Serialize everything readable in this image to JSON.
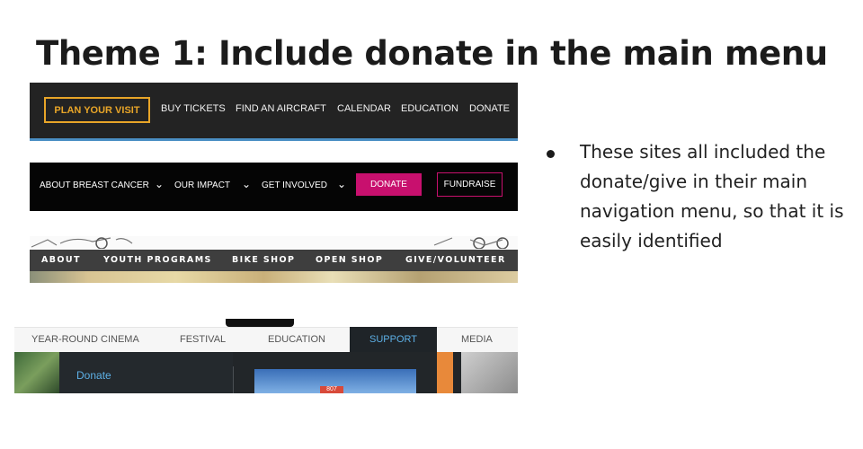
{
  "slide": {
    "title": "Theme 1: Include donate in the main menu",
    "bullet": "These sites all included the donate/give in their main navigation menu, so that it is easily identified"
  },
  "site1": {
    "plan_label": "PLAN YOUR VISIT",
    "nav": [
      "BUY TICKETS",
      "FIND AN AIRCRAFT",
      "CALENDAR",
      "EDUCATION",
      "DONATE"
    ],
    "accent_color": "#e8a528"
  },
  "site2": {
    "nav": [
      "ABOUT BREAST CANCER",
      "OUR IMPACT",
      "GET INVOLVED"
    ],
    "donate_label": "DONATE",
    "fundraise_label": "FUNDRAISE",
    "accent_color": "#c8106e"
  },
  "site3": {
    "nav": [
      "ABOUT",
      "YOUTH PROGRAMS",
      "BIKE SHOP",
      "OPEN SHOP",
      "GIVE/VOLUNTEER"
    ]
  },
  "site4": {
    "tabs": [
      "YEAR-ROUND CINEMA",
      "FESTIVAL",
      "EDUCATION",
      "SUPPORT",
      "MEDIA"
    ],
    "active_tab": "SUPPORT",
    "submenu_item": "Donate",
    "badge_text": "807",
    "active_color": "#5db0e6"
  }
}
